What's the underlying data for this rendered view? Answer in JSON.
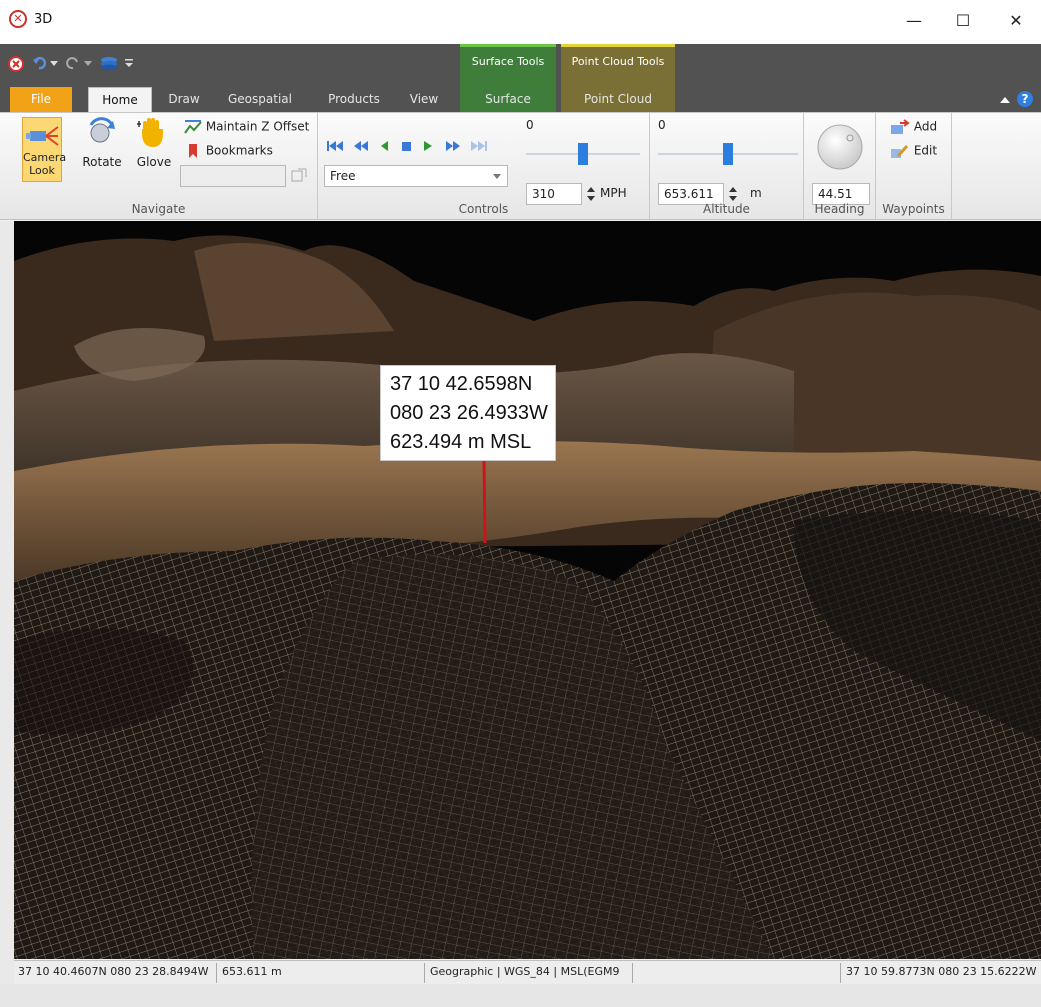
{
  "window": {
    "title": "3D",
    "minimize": "—",
    "maximize": "☐",
    "close": "✕"
  },
  "context_tabs": {
    "surface_tools": "Surface Tools",
    "point_cloud_tools": "Point Cloud Tools"
  },
  "tabs": [
    "File",
    "Home",
    "Draw",
    "Geospatial",
    "Products",
    "View",
    "Surface",
    "Point Cloud"
  ],
  "navigate": {
    "label": "Navigate",
    "camera_look": "Camera Look",
    "rotate": "Rotate",
    "glove": "Glove",
    "maintain_z_offset": "Maintain Z Offset",
    "bookmarks": "Bookmarks"
  },
  "controls": {
    "label": "Controls",
    "mode": "Free",
    "speed_min": "0",
    "speed_value": "310",
    "speed_unit": "MPH",
    "speed_fraction": 0.5
  },
  "altitude": {
    "label": "Altitude",
    "min": "0",
    "value": "653.611",
    "unit": "m",
    "fraction": 0.5
  },
  "heading": {
    "label": "Heading",
    "value": "44.51"
  },
  "waypoints": {
    "label": "Waypoints",
    "add": "Add",
    "edit": "Edit"
  },
  "point_label": {
    "lat": "37 10 42.6598N",
    "lon": "080 23 26.4933W",
    "elev": "623.494 m MSL"
  },
  "status": {
    "left_coords": "37 10 40.4607N 080 23 28.8494W",
    "left_alt": "653.611 m",
    "projection": "Geographic | WGS_84 | MSL(EGM9",
    "right_coords": "37 10 59.8773N 080 23 15.6222W"
  },
  "colors": {
    "file_tab": "#f1a216",
    "surface_ctx": "#3f7e3a",
    "cloud_ctx": "#7a6f34",
    "selected": "#fcd874"
  }
}
